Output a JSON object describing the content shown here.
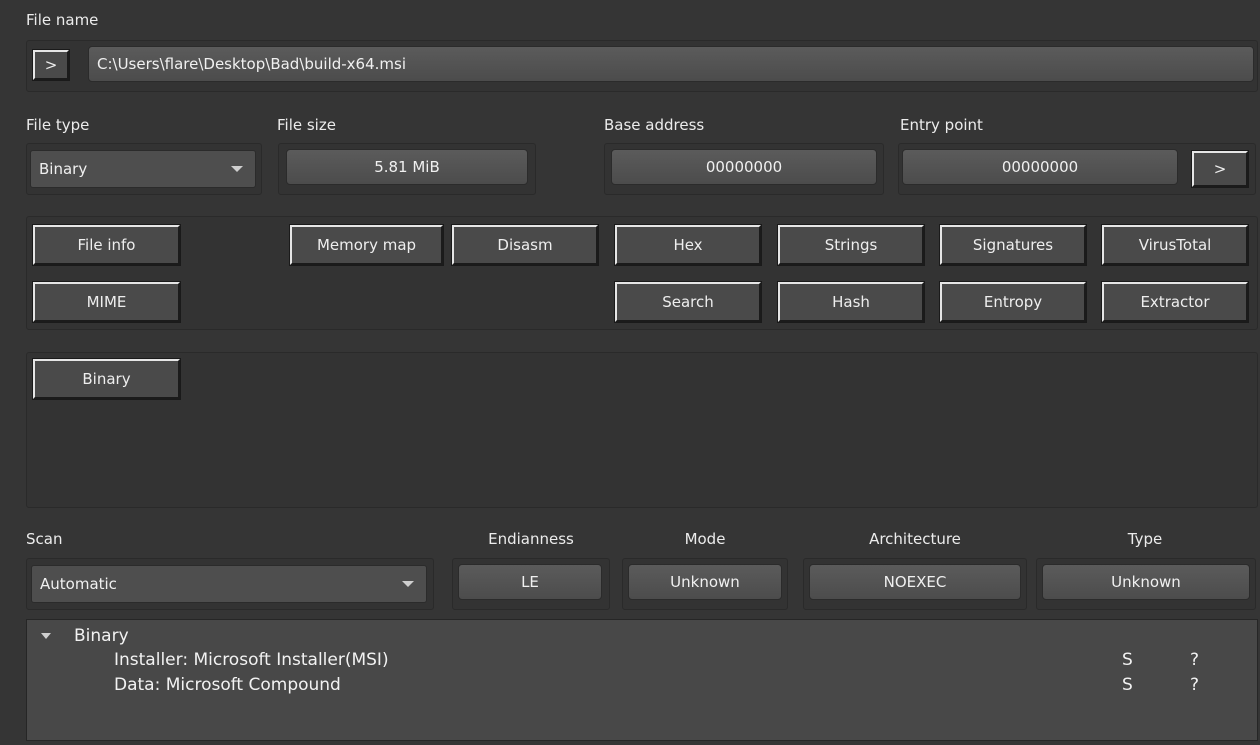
{
  "file_name": {
    "label": "File name",
    "open_button": ">",
    "path": "C:\\Users\\flare\\Desktop\\Bad\\build-x64.msi"
  },
  "info": {
    "file_type_label": "File type",
    "file_type_value": "Binary",
    "file_size_label": "File size",
    "file_size_value": "5.81 MiB",
    "base_address_label": "Base address",
    "base_address_value": "00000000",
    "entry_point_label": "Entry point",
    "entry_point_value": "00000000",
    "entry_point_button": ">"
  },
  "tools": {
    "file_info": "File info",
    "mime": "MIME",
    "memory_map": "Memory map",
    "disasm": "Disasm",
    "hex": "Hex",
    "strings": "Strings",
    "signatures": "Signatures",
    "virustotal": "VirusTotal",
    "search": "Search",
    "hash": "Hash",
    "entropy": "Entropy",
    "extractor": "Extractor"
  },
  "types_panel": {
    "binary_tab": "Binary"
  },
  "scan": {
    "scan_label": "Scan",
    "scan_value": "Automatic",
    "endianness_label": "Endianness",
    "endianness_value": "LE",
    "mode_label": "Mode",
    "mode_value": "Unknown",
    "architecture_label": "Architecture",
    "architecture_value": "NOEXEC",
    "type_label": "Type",
    "type_value": "Unknown"
  },
  "results": {
    "root": "Binary",
    "items": [
      {
        "text": "Installer: Microsoft Installer(MSI)",
        "flag": "S",
        "extra": "?"
      },
      {
        "text": "Data: Microsoft Compound",
        "flag": "S",
        "extra": "?"
      }
    ]
  }
}
